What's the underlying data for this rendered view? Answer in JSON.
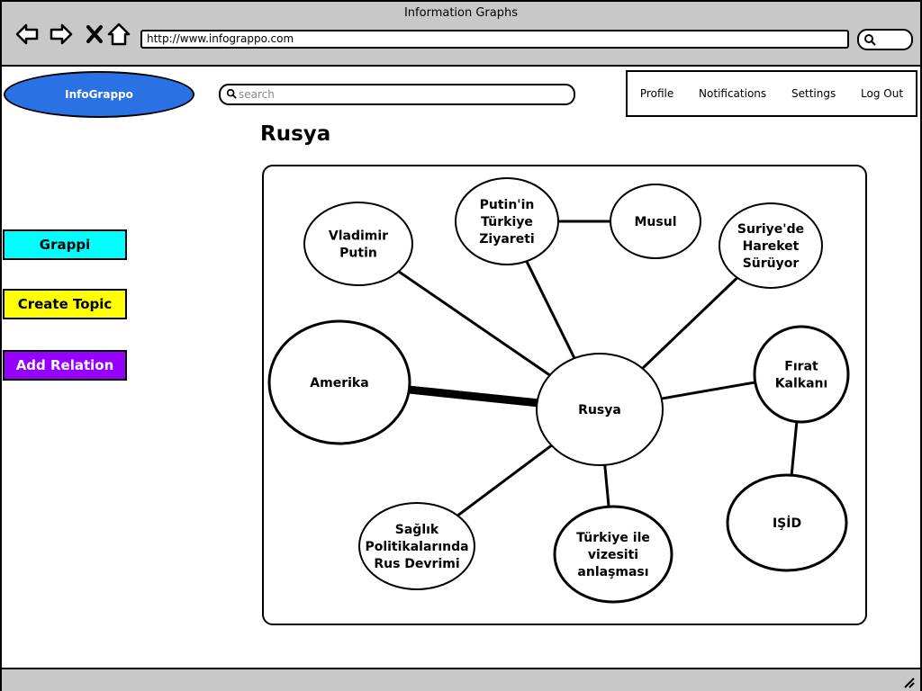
{
  "window": {
    "title": "Information Graphs",
    "url": "http://www.infograppo.com"
  },
  "header": {
    "logo": "InfoGrappo",
    "search_placeholder": "search",
    "menu": [
      "Profile",
      "Notifications",
      "Settings",
      "Log Out"
    ]
  },
  "sidebar": {
    "grappi": "Grappi",
    "create_topic": "Create Topic",
    "add_relation": "Add Relation"
  },
  "main": {
    "title": "Rusya"
  },
  "graph": {
    "nodes": [
      {
        "id": "rusya",
        "lines": [
          "Rusya"
        ],
        "bold": false
      },
      {
        "id": "vladimir",
        "lines": [
          "Vladimir",
          "Putin"
        ],
        "bold": false
      },
      {
        "id": "ziyaret",
        "lines": [
          "Putin'in",
          "Türkiye",
          "Ziyareti"
        ],
        "bold": false
      },
      {
        "id": "musul",
        "lines": [
          "Musul"
        ],
        "bold": false
      },
      {
        "id": "suriye",
        "lines": [
          "Suriye'de",
          "Hareket",
          "Sürüyor"
        ],
        "bold": false
      },
      {
        "id": "amerika",
        "lines": [
          "Amerika"
        ],
        "bold": true
      },
      {
        "id": "firat",
        "lines": [
          "Fırat",
          "Kalkanı"
        ],
        "bold": true
      },
      {
        "id": "isid",
        "lines": [
          "IŞİD"
        ],
        "bold": true
      },
      {
        "id": "saglik",
        "lines": [
          "Sağlık",
          "Politikalarında",
          "Rus Devrimi"
        ],
        "bold": false
      },
      {
        "id": "vize",
        "lines": [
          "Türkiye ile",
          "vizesiti",
          "anlaşması"
        ],
        "bold": true
      }
    ],
    "edges": [
      {
        "from": "rusya",
        "to": "vladimir",
        "strength": 1
      },
      {
        "from": "rusya",
        "to": "ziyaret",
        "strength": 1
      },
      {
        "from": "ziyaret",
        "to": "musul",
        "strength": 1
      },
      {
        "from": "rusya",
        "to": "suriye",
        "strength": 1
      },
      {
        "from": "rusya",
        "to": "amerika",
        "strength": 3
      },
      {
        "from": "rusya",
        "to": "firat",
        "strength": 1
      },
      {
        "from": "firat",
        "to": "isid",
        "strength": 1
      },
      {
        "from": "rusya",
        "to": "saglik",
        "strength": 1
      },
      {
        "from": "rusya",
        "to": "vize",
        "strength": 1
      }
    ]
  }
}
